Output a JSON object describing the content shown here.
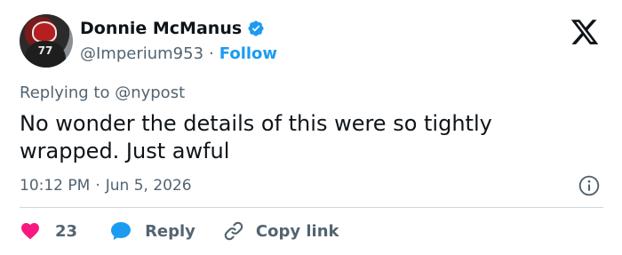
{
  "author": {
    "display_name": "Donnie McManus",
    "handle": "@Imperium953",
    "avatar_jersey_number": "77"
  },
  "header": {
    "separator": "·",
    "follow_label": "Follow",
    "logo_icon": "x-logo-icon"
  },
  "tweet": {
    "replying_to": "Replying to @nypost",
    "text": "No wonder the details of this were so tightly wrapped. Just awful",
    "time": "10:12 PM",
    "date": "Jun 5, 2026"
  },
  "actions": {
    "like_count": "23",
    "reply_label": "Reply",
    "copy_link_label": "Copy link"
  },
  "colors": {
    "accent": "#1d9bf0",
    "heart": "#f91880",
    "text_primary": "#0f1419",
    "text_secondary": "#536471",
    "divider": "#cfd9de"
  }
}
